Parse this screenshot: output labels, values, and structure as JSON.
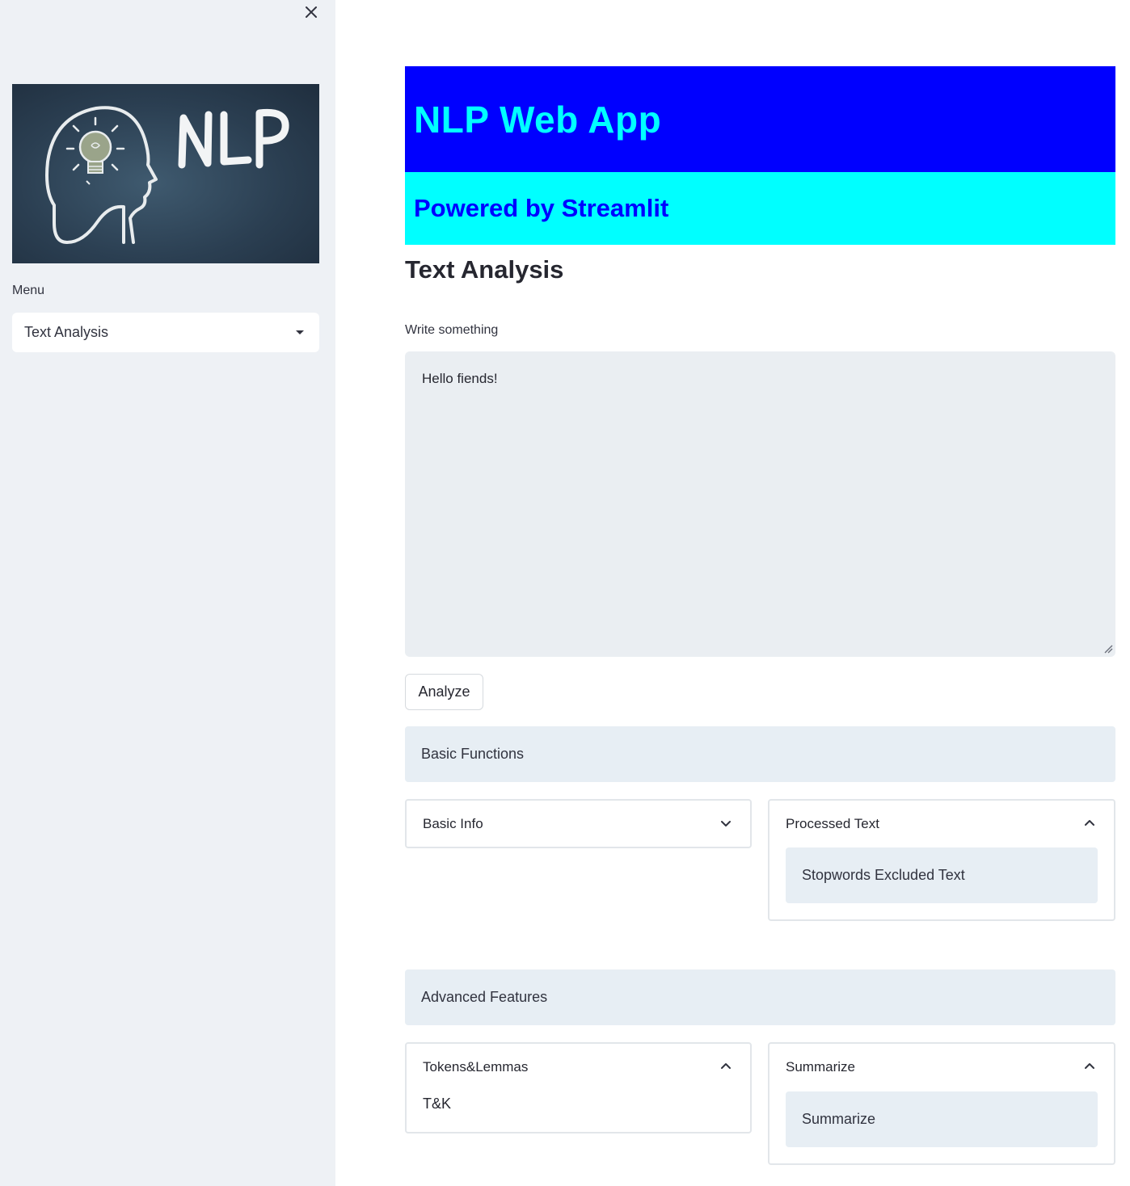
{
  "sidebar": {
    "logo_text": "NLP",
    "menu_label": "Menu",
    "menu_selected": "Text Analysis"
  },
  "main": {
    "title": "NLP Web App",
    "subtitle": "Powered by Streamlit",
    "section_title": "Text Analysis",
    "input_label": "Write something",
    "input_value": "Hello fiends!",
    "analyze_button": "Analyze",
    "basic_functions": {
      "title": "Basic Functions",
      "basic_info": {
        "label": "Basic Info",
        "state": "collapsed"
      },
      "processed_text": {
        "label": "Processed Text",
        "state": "expanded",
        "content": "Stopwords Excluded Text"
      }
    },
    "advanced_features": {
      "title": "Advanced Features",
      "tokens_lemmas": {
        "label": "Tokens&Lemmas",
        "state": "expanded",
        "content": "T&K"
      },
      "summarize": {
        "label": "Summarize",
        "state": "expanded",
        "content": "Summarize"
      }
    }
  },
  "colors": {
    "title_bg": "#0000ff",
    "title_fg": "#00ffff",
    "subtitle_bg": "#00ffff",
    "subtitle_fg": "#0000ff",
    "sidebar_bg": "#eef1f5",
    "info_box_bg": "#e7eef4"
  },
  "icons": {
    "close": "close-icon",
    "dropdown": "caret-down-icon",
    "collapsed": "chevron-down-icon",
    "expanded": "chevron-up-icon"
  }
}
